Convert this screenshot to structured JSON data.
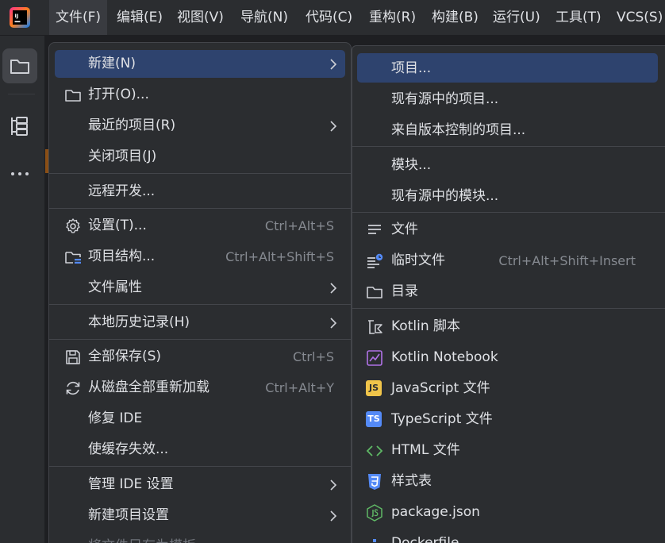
{
  "colors": {
    "menubar_bg": "#2b2d30",
    "popup_bg": "#2b2d30",
    "highlight": "#2e436e",
    "text": "#dfe1e5",
    "shortcut": "#868a91",
    "separator": "#43454a"
  },
  "menubar": {
    "logo_icon": "intellij-idea-logo",
    "items": [
      {
        "label": "文件(F)"
      },
      {
        "label": "编辑(E)"
      },
      {
        "label": "视图(V)"
      },
      {
        "label": "导航(N)"
      },
      {
        "label": "代码(C)"
      },
      {
        "label": "重构(R)"
      },
      {
        "label": "构建(B)"
      },
      {
        "label": "运行(U)"
      },
      {
        "label": "工具(T)"
      },
      {
        "label": "VCS(S)"
      }
    ]
  },
  "left_toolbar": {
    "icons": [
      "project-folder-icon",
      "structure-icon",
      "more-icon"
    ]
  },
  "file_menu": {
    "items": [
      {
        "label": "新建(N)",
        "icon": "",
        "shortcut": "",
        "submenu": true
      },
      {
        "label": "打开(O)...",
        "icon": "folder-icon",
        "shortcut": "",
        "submenu": false
      },
      {
        "label": "最近的项目(R)",
        "icon": "",
        "shortcut": "",
        "submenu": true
      },
      {
        "label": "关闭项目(J)",
        "icon": "",
        "shortcut": "",
        "submenu": false
      },
      {
        "label": "远程开发...",
        "icon": "",
        "shortcut": "",
        "submenu": false
      },
      {
        "label": "设置(T)...",
        "icon": "gear-icon",
        "shortcut": "Ctrl+Alt+S",
        "submenu": false
      },
      {
        "label": "项目结构...",
        "icon": "project-structure-icon",
        "shortcut": "Ctrl+Alt+Shift+S",
        "submenu": false
      },
      {
        "label": "文件属性",
        "icon": "",
        "shortcut": "",
        "submenu": true
      },
      {
        "label": "本地历史记录(H)",
        "icon": "",
        "shortcut": "",
        "submenu": true
      },
      {
        "label": "全部保存(S)",
        "icon": "save-icon",
        "shortcut": "Ctrl+S",
        "submenu": false
      },
      {
        "label": "从磁盘全部重新加载",
        "icon": "reload-icon",
        "shortcut": "Ctrl+Alt+Y",
        "submenu": false
      },
      {
        "label": "修复 IDE",
        "icon": "",
        "shortcut": "",
        "submenu": false
      },
      {
        "label": "使缓存失效...",
        "icon": "",
        "shortcut": "",
        "submenu": false
      },
      {
        "label": "管理 IDE 设置",
        "icon": "",
        "shortcut": "",
        "submenu": true
      },
      {
        "label": "新建项目设置",
        "icon": "",
        "shortcut": "",
        "submenu": true
      },
      {
        "label": "将文件另存为模板...",
        "icon": "",
        "shortcut": "",
        "submenu": false
      }
    ]
  },
  "new_submenu": {
    "items": [
      {
        "label": "项目...",
        "icon": "",
        "shortcut": ""
      },
      {
        "label": "现有源中的项目...",
        "icon": "",
        "shortcut": ""
      },
      {
        "label": "来自版本控制的项目...",
        "icon": "",
        "shortcut": ""
      },
      {
        "label": "模块...",
        "icon": "",
        "shortcut": ""
      },
      {
        "label": "现有源中的模块...",
        "icon": "",
        "shortcut": ""
      },
      {
        "label": "文件",
        "icon": "text-file-icon",
        "shortcut": ""
      },
      {
        "label": "临时文件",
        "icon": "scratch-file-icon",
        "shortcut": "Ctrl+Alt+Shift+Insert"
      },
      {
        "label": "目录",
        "icon": "folder-icon",
        "shortcut": ""
      },
      {
        "label": "Kotlin 脚本",
        "icon": "kotlin-script-icon",
        "shortcut": ""
      },
      {
        "label": "Kotlin Notebook",
        "icon": "kotlin-notebook-icon",
        "shortcut": ""
      },
      {
        "label": "JavaScript 文件",
        "icon": "javascript-icon",
        "icon_text": "JS",
        "shortcut": ""
      },
      {
        "label": "TypeScript 文件",
        "icon": "typescript-icon",
        "icon_text": "TS",
        "shortcut": ""
      },
      {
        "label": "HTML 文件",
        "icon": "html-icon",
        "shortcut": ""
      },
      {
        "label": "样式表",
        "icon": "css-icon",
        "shortcut": ""
      },
      {
        "label": "package.json",
        "icon": "nodejs-icon",
        "shortcut": ""
      },
      {
        "label": "Dockerfile",
        "icon": "docker-icon",
        "shortcut": ""
      }
    ]
  }
}
